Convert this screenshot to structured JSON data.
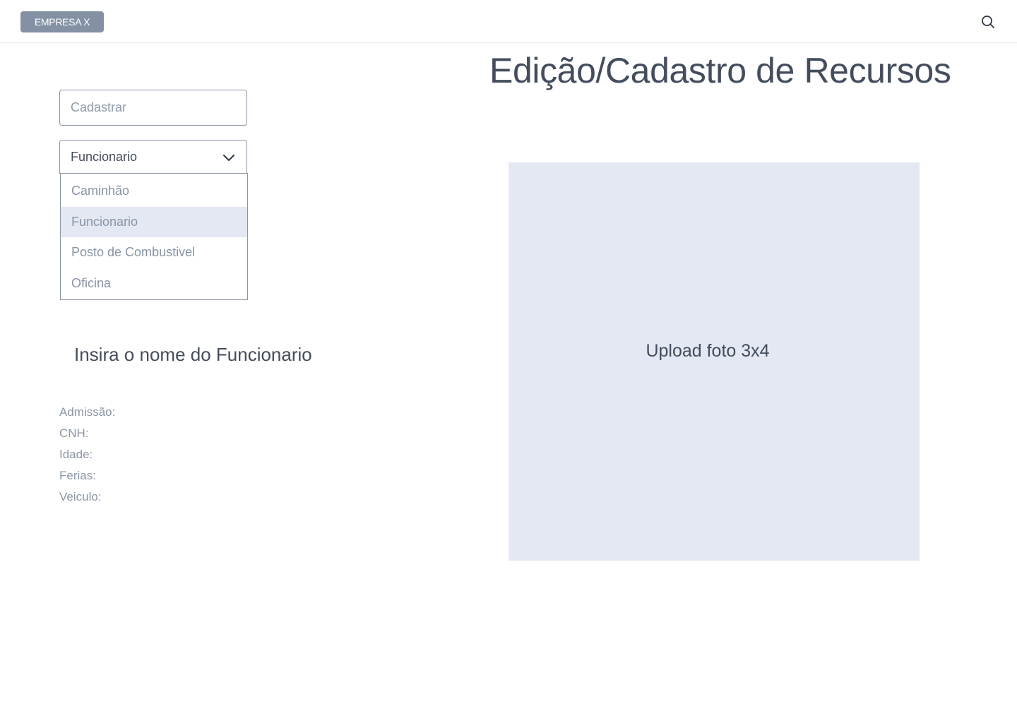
{
  "header": {
    "brand": "EMPRESA X",
    "search_icon": "search-icon"
  },
  "title": "Edição/Cadastro de Recursos",
  "form": {
    "register_placeholder": "Cadastrar",
    "resource_type": {
      "selected": "Funcionario",
      "options": [
        "Caminhão",
        "Funcionario",
        "Posto de Combustivel",
        "Oficina"
      ],
      "chevron_icon": "chevron-down-icon"
    }
  },
  "employee": {
    "name_prompt": "Insira o nome do Funcionario",
    "details": [
      "Admissão:",
      "CNH:",
      "Idade:",
      "Ferias:",
      "Veiculo:"
    ]
  },
  "upload": {
    "label": "Upload foto 3x4"
  },
  "colors": {
    "brand_badge": "#8491a5",
    "text_dark": "#434d5d",
    "text_muted": "#8a96a8",
    "selected_bg": "#e4e8f2",
    "border": "#8c96a6"
  }
}
